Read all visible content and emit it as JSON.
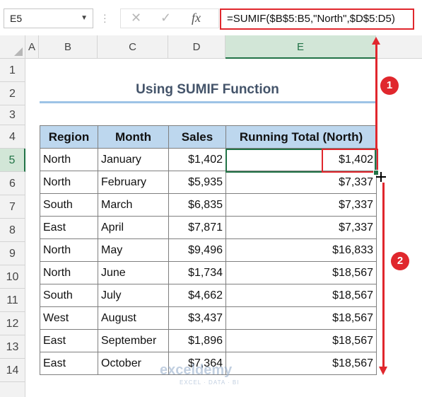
{
  "formula_bar": {
    "name_box": "E5",
    "cancel_glyph": "✕",
    "enter_glyph": "✓",
    "fx_label": "fx",
    "formula": "=SUMIF($B$5:B5,\"North\",$D$5:D5)"
  },
  "columns": [
    "A",
    "B",
    "C",
    "D",
    "E"
  ],
  "selected_column": "E",
  "rows": [
    "1",
    "2",
    "3",
    "4",
    "5",
    "6",
    "7",
    "8",
    "9",
    "10",
    "11",
    "12",
    "13",
    "14"
  ],
  "selected_row": "5",
  "title": "Using SUMIF Function",
  "table": {
    "headers": [
      "Region",
      "Month",
      "Sales",
      "Running Total (North)"
    ],
    "rows": [
      [
        "North",
        "January",
        "$1,402",
        "$1,402"
      ],
      [
        "North",
        "February",
        "$5,935",
        "$7,337"
      ],
      [
        "South",
        "March",
        "$6,835",
        "$7,337"
      ],
      [
        "East",
        "April",
        "$7,871",
        "$7,337"
      ],
      [
        "North",
        "May",
        "$9,496",
        "$16,833"
      ],
      [
        "North",
        "June",
        "$1,734",
        "$18,567"
      ],
      [
        "South",
        "July",
        "$4,662",
        "$18,567"
      ],
      [
        "West",
        "August",
        "$3,437",
        "$18,567"
      ],
      [
        "East",
        "September",
        "$1,896",
        "$18,567"
      ],
      [
        "East",
        "October",
        "$7,364",
        "$18,567"
      ]
    ]
  },
  "badges": [
    "1",
    "2"
  ],
  "watermark": {
    "name": "exceldemy",
    "tagline": "EXCEL · DATA · BI"
  },
  "colors": {
    "accent_red": "#e0272d",
    "header_fill": "#bdd7ee",
    "excel_green": "#217346"
  }
}
